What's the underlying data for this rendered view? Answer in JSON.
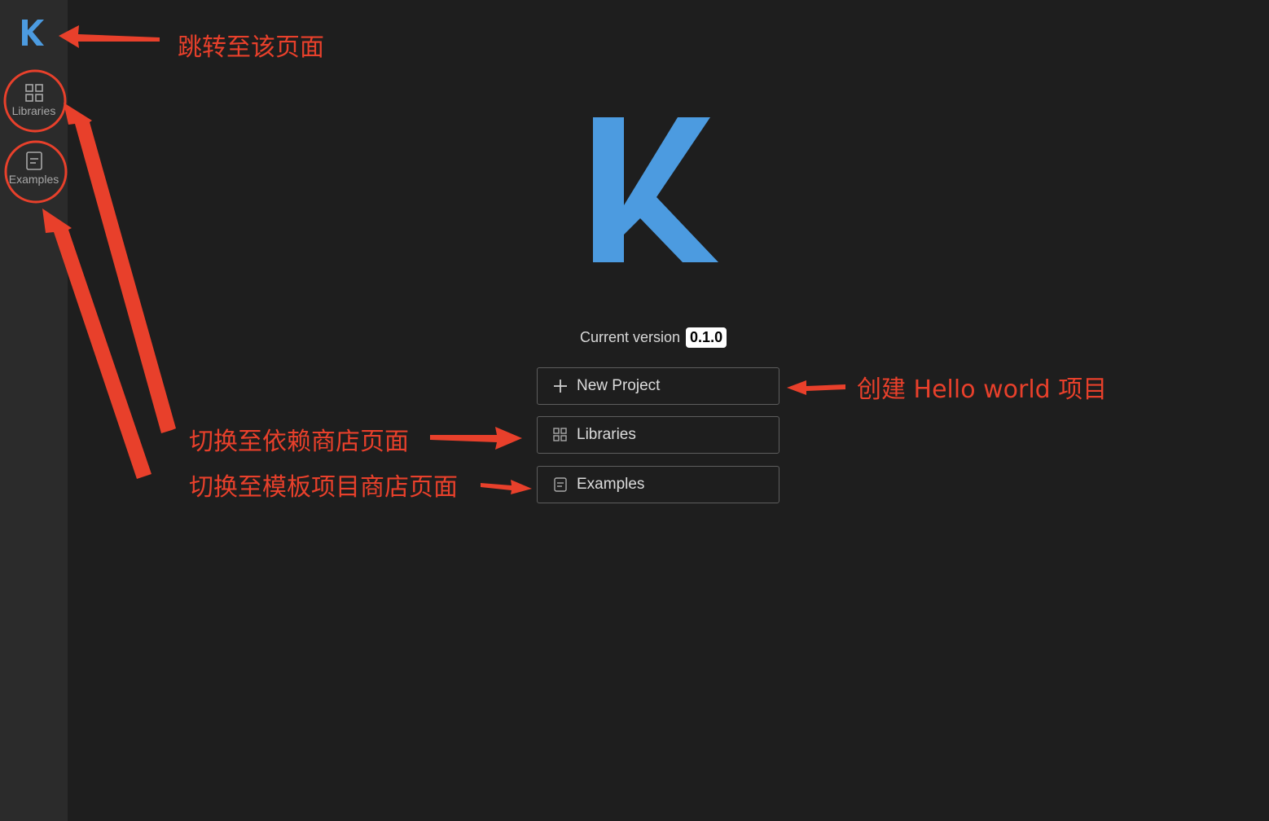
{
  "sidebar": {
    "logo_letter": "K",
    "items": [
      {
        "label": "Libraries",
        "icon": "grid-icon"
      },
      {
        "label": "Examples",
        "icon": "document-icon"
      }
    ]
  },
  "main": {
    "logo_letter": "K",
    "version_label": "Current version",
    "version_value": "0.1.0",
    "buttons": [
      {
        "label": "New Project",
        "icon": "plus-icon"
      },
      {
        "label": "Libraries",
        "icon": "grid-icon"
      },
      {
        "label": "Examples",
        "icon": "document-icon"
      }
    ]
  },
  "annotations": {
    "logo_note": "跳转至该页面",
    "libraries_note": "切换至依赖商店页面",
    "examples_note": "切换至模板项目商店页面",
    "new_project_note": "创建 Hello world 项目"
  },
  "colors": {
    "background": "#1e1e1e",
    "sidebar": "#2b2b2b",
    "brand_blue": "#4c9be0",
    "annotation_red": "#e8402b"
  }
}
